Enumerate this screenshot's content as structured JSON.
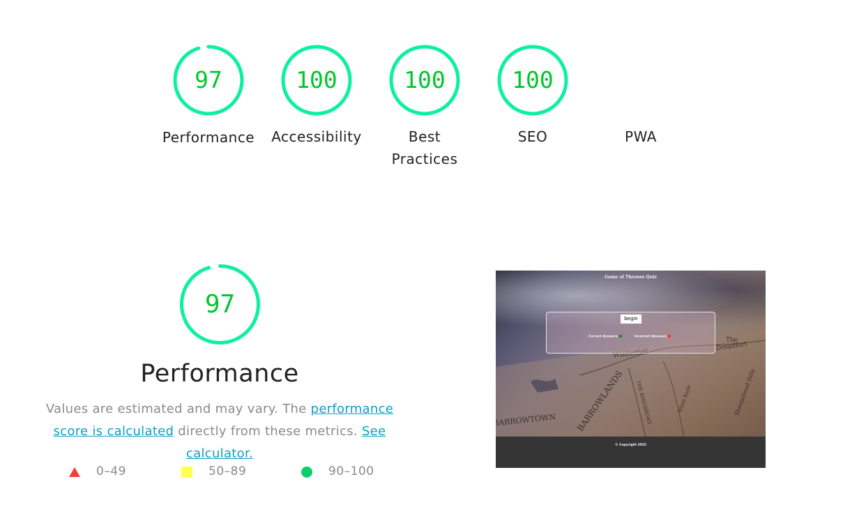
{
  "gauges": [
    {
      "id": "performance",
      "score": "97",
      "label": "Performance",
      "fraction": 0.97
    },
    {
      "id": "accessibility",
      "score": "100",
      "label": "Accessibility",
      "fraction": 1.0
    },
    {
      "id": "best-practices",
      "score": "100",
      "label_line1": "Best",
      "label_line2": "Practices",
      "fraction": 1.0
    },
    {
      "id": "seo",
      "score": "100",
      "label": "SEO",
      "fraction": 1.0
    },
    {
      "id": "pwa",
      "label": "PWA"
    }
  ],
  "performance_section": {
    "score": "97",
    "fraction": 0.97,
    "title": "Performance",
    "desc_text1": "Values are estimated and may vary. The ",
    "desc_link1": "performance score is calculated",
    "desc_text2": " directly from these metrics. ",
    "desc_link2": "See calculator."
  },
  "legend": [
    {
      "range": "0–49",
      "shape": "triangle",
      "color": "#f33f33"
    },
    {
      "range": "50–89",
      "shape": "square",
      "color": "#ffff55"
    },
    {
      "range": "90–100",
      "shape": "circle",
      "color": "#0cce6b"
    }
  ],
  "colors": {
    "gauge_ring": "#0cf0a0",
    "gauge_text": "#00c72b",
    "link": "#0b9fc4"
  },
  "screenshot": {
    "site_title": "Game of Thrones Quiz",
    "begin_label": "begin",
    "correct_label": "Correct Answers",
    "incorrect_label": "Incorrect Answers",
    "copyright": "© Copyright 2022",
    "map_labels": {
      "winterfell": "Winterfell",
      "dreadfort_1": "The",
      "dreadfort_2": "Dreadfort",
      "barrowlands": "BARROWLANDS",
      "kingsroad": "THE KINGSROAD",
      "barrowtown": "BARROWTOWN",
      "sheepshead": "Sheepshead Hills",
      "white_knife": "White Knife"
    }
  }
}
